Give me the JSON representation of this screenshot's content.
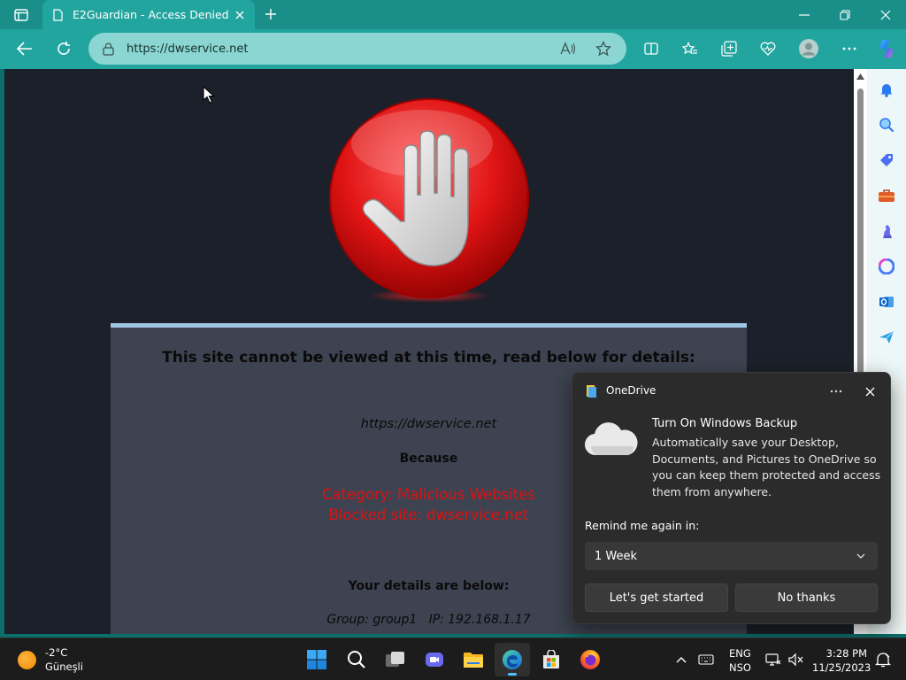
{
  "browser": {
    "tab_title": "E2Guardian - Access Denied",
    "url": "https://dwservice.net"
  },
  "page": {
    "heading": "This site cannot be viewed at this time, read below for details:",
    "blocked_url": "https://dwservice.net",
    "because": "Because",
    "category_line": "Category: Malicious Websites",
    "blocked_line": "Blocked site: dwservice.net",
    "details_heading": "Your details are below:",
    "details_line": "Group: group1   IP: 192.168.1.17"
  },
  "toast": {
    "app_name": "OneDrive",
    "title": "Turn On Windows Backup",
    "body": "Automatically save your Desktop, Documents, and Pictures to OneDrive so you can keep them protected and access them from anywhere.",
    "remind_label": "Remind me again in:",
    "remind_value": "1 Week",
    "primary_button": "Let's get started",
    "secondary_button": "No thanks"
  },
  "taskbar": {
    "weather_temp": "-2°C",
    "weather_desc": "Güneşli",
    "lang_top": "ENG",
    "lang_bottom": "NSO",
    "time": "3:28 PM",
    "date": "11/25/2023"
  },
  "colors": {
    "accent": "#23a59f",
    "blocked_text": "#e01010",
    "panel_bg": "#3e4351",
    "page_bg": "#1b202a"
  }
}
